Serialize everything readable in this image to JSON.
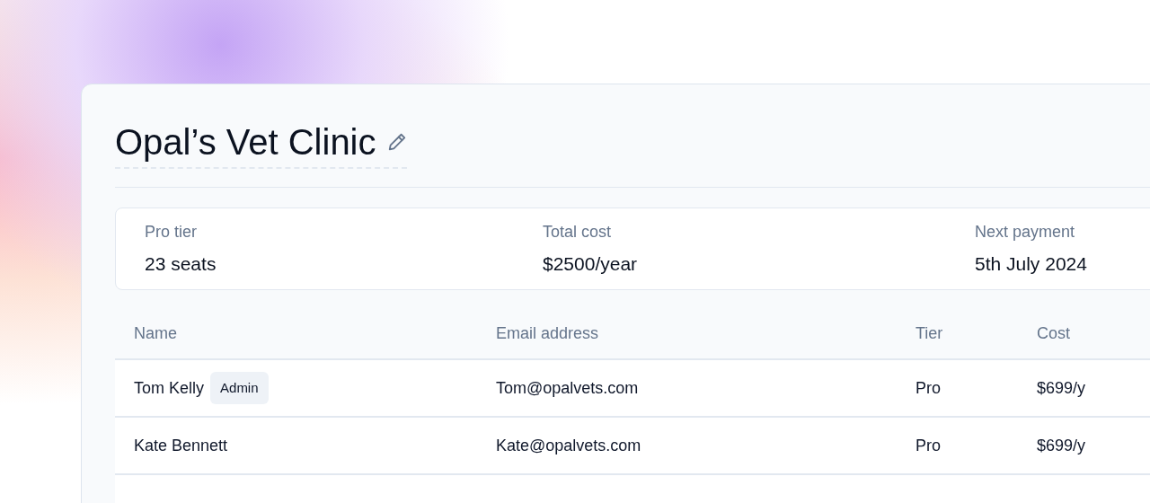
{
  "title": "Opal’s Vet Clinic",
  "summary": [
    {
      "label": "Pro tier",
      "value": "23 seats"
    },
    {
      "label": "Total cost",
      "value": "$2500/year"
    },
    {
      "label": "Next payment",
      "value": "5th July 2024"
    }
  ],
  "table": {
    "columns": [
      "Name",
      "Email address",
      "Tier",
      "Cost"
    ],
    "rows": [
      {
        "name": "Tom Kelly",
        "badge": "Admin",
        "email": "Tom@opalvets.com",
        "tier": "Pro",
        "cost": "$699/y"
      },
      {
        "name": "Kate Bennett",
        "email": "Kate@opalvets.com",
        "tier": "Pro",
        "cost": "$699/y"
      }
    ]
  }
}
